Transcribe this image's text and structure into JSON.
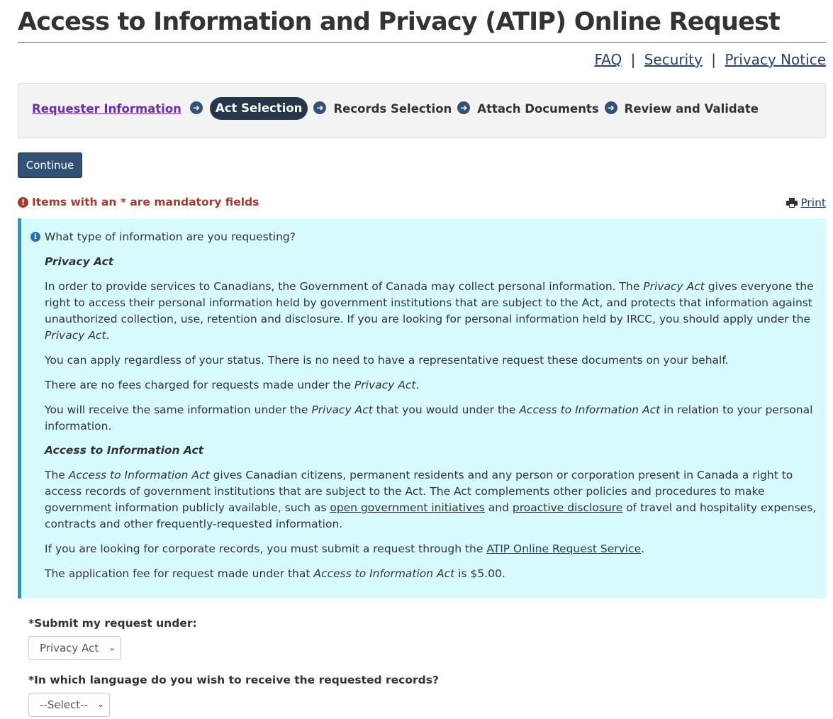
{
  "page": {
    "title": "Access to Information and Privacy (ATIP) Online Request"
  },
  "top_links": {
    "faq": "FAQ",
    "separator": "|",
    "security": "Security",
    "privacy_notice": "Privacy Notice"
  },
  "steps": {
    "items": [
      {
        "label": "Requester Information",
        "state": "link"
      },
      {
        "label": "Act Selection",
        "state": "active"
      },
      {
        "label": "Records Selection",
        "state": "pending"
      },
      {
        "label": "Attach Documents",
        "state": "pending"
      },
      {
        "label": "Review and Validate",
        "state": "pending"
      }
    ]
  },
  "actions": {
    "continue_label": "Continue",
    "print_label": "Print"
  },
  "notice": {
    "mandatory": "Items with an * are mandatory fields"
  },
  "info": {
    "question": "What type of information are you requesting?",
    "privacy_heading": "Privacy Act",
    "privacy_p1": {
      "a": "In order to provide services to Canadians, the Government of Canada may collect personal information. The ",
      "em1": "Privacy Act",
      "b": " gives everyone the right to access their personal information held by government institutions that are subject to the Act, and protects that information against unauthorized collection, use, retention and disclosure. If you are looking for personal information held by IRCC, you should apply under the ",
      "em2": "Privacy Act",
      "c": "."
    },
    "privacy_p2": "You can apply regardless of your status. There is no need to have a representative request these documents on your behalf.",
    "privacy_p3": {
      "a": "There are no fees charged for requests made under the ",
      "em": "Privacy Act",
      "b": "."
    },
    "privacy_p4": {
      "a": "You will receive the same information under the ",
      "em1": "Privacy Act",
      "b": " that you would under the ",
      "em2": "Access to Information Act",
      "c": " in relation to your personal information."
    },
    "ati_heading": "Access to Information Act",
    "ati_p1": {
      "a": "The ",
      "em": "Access to Information Act",
      "b": " gives Canadian citizens, permanent residents and any person or corporation present in Canada a right to access records of government institutions that are subject to the Act. The Act complements other policies and procedures to make government information publicly available, such as ",
      "link1": "open government initiatives",
      "c": " and ",
      "link2": "proactive disclosure",
      "d": " of travel and hospitality expenses, contracts and other frequently-requested information."
    },
    "ati_p2": {
      "a": "If you are looking for corporate records, you must submit a request through the ",
      "link": "ATIP Online Request Service",
      "b": "."
    },
    "ati_p3": {
      "a": "The application fee for request made under that ",
      "em": "Access to Information Act",
      "b": " is $5.00."
    }
  },
  "form": {
    "submit_under_label": "*Submit my request under:",
    "submit_under_value": "Privacy Act",
    "language_label": "*In which language do you wish to receive the requested records?",
    "language_value": "--Select--"
  },
  "icons": {
    "step_arrow": "arrow-circle-right-icon",
    "mandatory": "exclamation-circle-icon",
    "print": "printer-icon",
    "info": "info-circle-icon"
  },
  "colors": {
    "title_rule": "#a63a3a",
    "active_step": "#26374a",
    "continue_button": "#335075",
    "mandatory_text": "#a33b2f",
    "info_background": "#d7faff",
    "info_border": "#269abc"
  }
}
